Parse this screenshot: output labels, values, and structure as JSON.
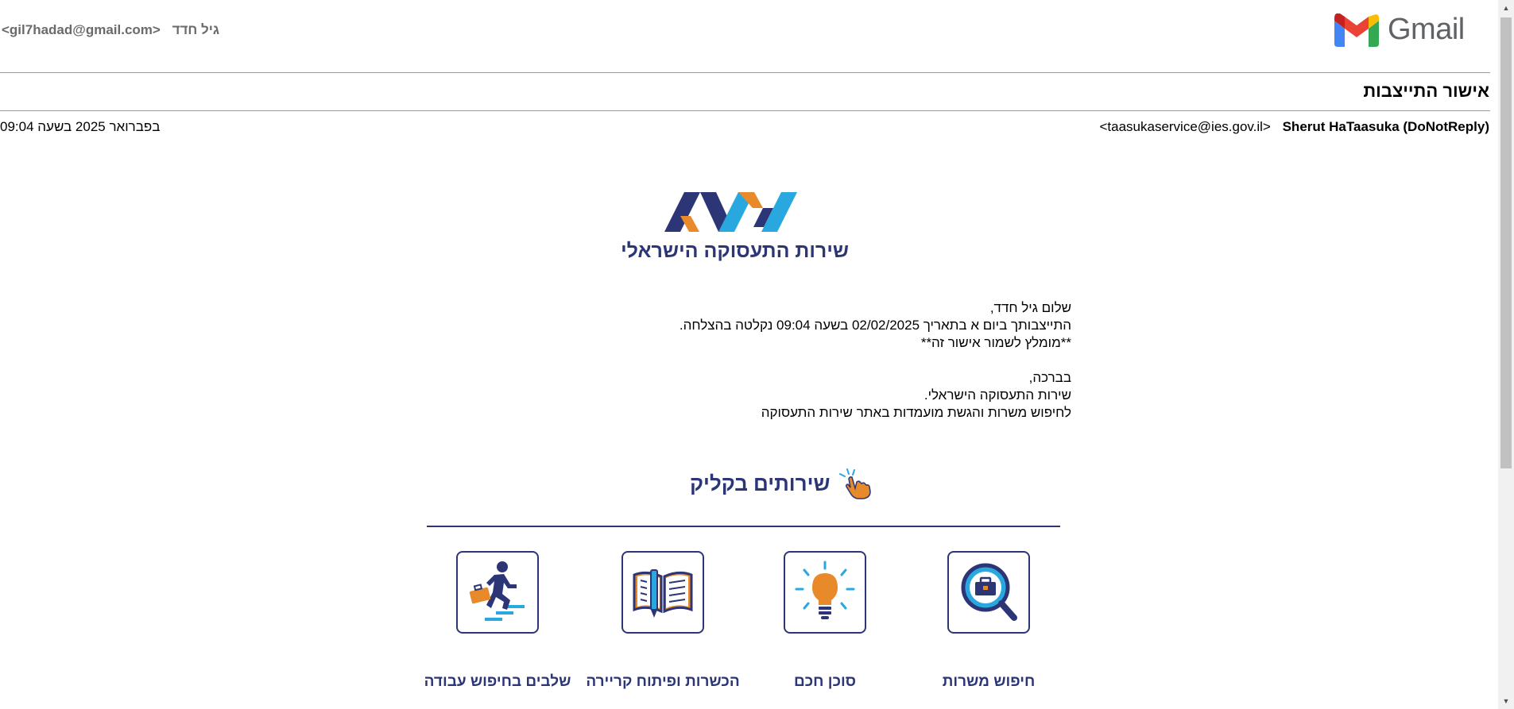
{
  "header": {
    "user_email": "<gil7hadad@gmail.com>",
    "user_name": "גיל חדד",
    "gmail_word": "Gmail"
  },
  "email": {
    "subject": "אישור התייצבות",
    "sender_name": "Sherut HaTaasuka (DoNotReply)",
    "sender_email": "<taasukaservice@ies.gov.il>",
    "date": "2 בפברואר 2025 בשעה 09:04"
  },
  "logo": {
    "org_name": "שירות התעסוקה הישראלי",
    "colors": {
      "navy": "#2c3677",
      "orange": "#e88a2a",
      "blue": "#29a8e0"
    }
  },
  "body": {
    "greeting": "שלום גיל חדד,",
    "line1": "התייצבותך ביום א בתאריך 02/02/2025 בשעה 09:04 נקלטה בהצלחה.",
    "line2": "**מומלץ לשמור אישור זה**",
    "closing": "בברכה,",
    "signature": "שירות התעסוקה הישראלי.",
    "cta": "לחיפוש משרות והגשת מועמדות באתר שירות התעסוקה"
  },
  "quick_services": {
    "title": "שירותים בקליק",
    "items": [
      {
        "label": "חיפוש משרות",
        "icon": "job-search-icon"
      },
      {
        "label": "סוכן חכם",
        "icon": "lightbulb-icon"
      },
      {
        "label": "הכשרות ופיתוח קריירה",
        "icon": "book-icon"
      },
      {
        "label": "שלבים בחיפוש עבודה",
        "icon": "stairs-runner-icon"
      }
    ]
  }
}
